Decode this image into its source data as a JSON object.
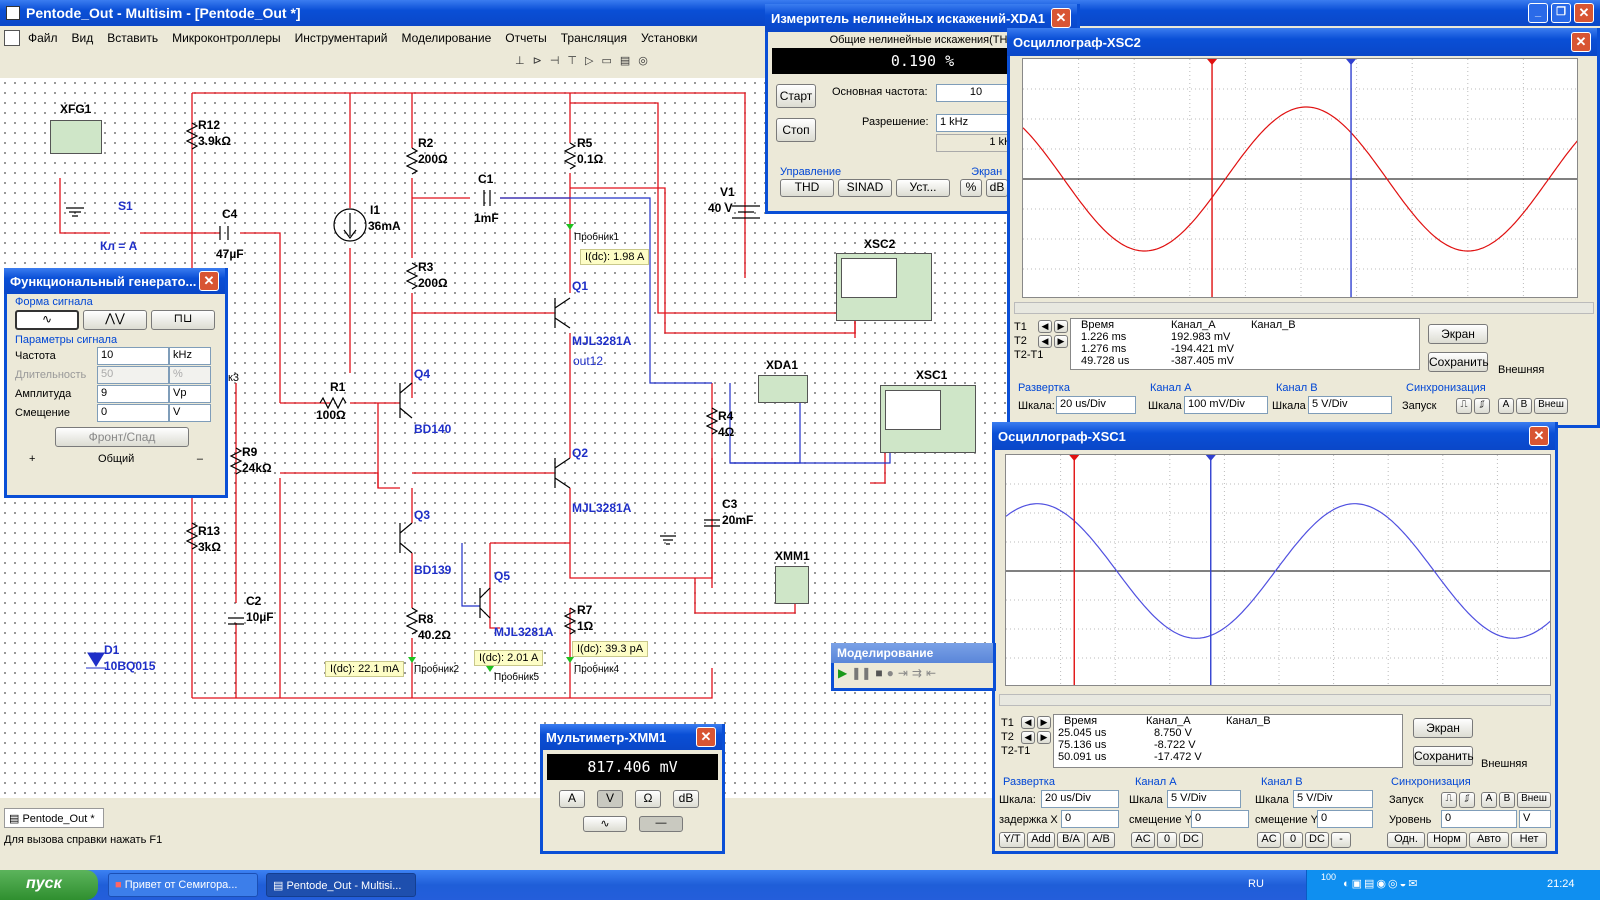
{
  "app": {
    "title": "Pentode_Out - Multisim - [Pentode_Out *]",
    "menu": [
      "Файл",
      "Вид",
      "Вставить",
      "Микроконтроллеры",
      "Инструментарий",
      "Моделирование",
      "Отчеты",
      "Трансляция",
      "Установки"
    ],
    "doc_tab": "Pentode_Out *",
    "status": "Для вызова справки нажать F1"
  },
  "schematic": {
    "components": [
      {
        "ref": "XFG1"
      },
      {
        "ref": "R12",
        "value": "3.9kΩ"
      },
      {
        "ref": "S1",
        "value": "Кл = A"
      },
      {
        "ref": "C4",
        "value": "47µF"
      },
      {
        "ref": "I1",
        "value": "36mA"
      },
      {
        "ref": "R2",
        "value": "200Ω"
      },
      {
        "ref": "C1",
        "value": "1mF"
      },
      {
        "ref": "R5",
        "value": "0.1Ω"
      },
      {
        "ref": "V1",
        "value": "40 V"
      },
      {
        "ref": "R3",
        "value": "200Ω"
      },
      {
        "ref": "Q1",
        "value": "MJL3281A"
      },
      {
        "ref": "R1",
        "value": "100Ω"
      },
      {
        "ref": "Q4",
        "value": "BD140"
      },
      {
        "ref": "R9",
        "value": "24kΩ"
      },
      {
        "ref": "Q2",
        "value": "MJL3281A"
      },
      {
        "ref": "R4",
        "value": "4Ω"
      },
      {
        "ref": "C3",
        "value": "20mF"
      },
      {
        "ref": "Q3",
        "value": "BD139"
      },
      {
        "ref": "Q5",
        "value": "MJL3281A"
      },
      {
        "ref": "R13",
        "value": "3kΩ"
      },
      {
        "ref": "C2",
        "value": "10µF"
      },
      {
        "ref": "R8",
        "value": "40.2Ω"
      },
      {
        "ref": "R7",
        "value": "1Ω"
      },
      {
        "ref": "D1",
        "value": "10BQ015"
      },
      {
        "ref": "XSC2"
      },
      {
        "ref": "XDA1"
      },
      {
        "ref": "XSC1"
      },
      {
        "ref": "XMM1"
      }
    ],
    "probes": [
      {
        "label": "Пробник1",
        "value": "I(dc): 1.98 A"
      },
      {
        "label": "Пробник2",
        "value": "I(dc): 22.1 mA"
      },
      {
        "label": "Пробник5",
        "value": "I(dc): 2.01 A"
      },
      {
        "label": "Пробник4",
        "value": "I(dc): 39.3 pA"
      }
    ],
    "net_label": "out12",
    "partial_label": "к3"
  },
  "funcgen": {
    "title": "Функциональный генерато...",
    "group_wave": "Форма сигнала",
    "group_params": "Параметры сигнала",
    "params": [
      {
        "label": "Частота",
        "value": "10",
        "unit": "kHz",
        "enabled": true
      },
      {
        "label": "Длительность",
        "value": "50",
        "unit": "%",
        "enabled": false
      },
      {
        "label": "Амплитуда",
        "value": "9",
        "unit": "Vp",
        "enabled": true
      },
      {
        "label": "Смещение",
        "value": "0",
        "unit": "V",
        "enabled": true
      }
    ],
    "edge_button": "Фронт/Спад",
    "plus": "+",
    "common": "Общий",
    "minus": "–"
  },
  "distortion": {
    "title": "Измеритель нелинейных искажений-XDA1",
    "header": "Общие нелинейные искажения(THD",
    "display": "0.190 %",
    "start": "Старт",
    "stop": "Стоп",
    "fund_label": "Основная частота:",
    "fund_value": "10",
    "res_label": "Разрешение:",
    "res_value": "1 kHz",
    "res_extra": "1 kH",
    "ctrl_group": "Управление",
    "screen_group": "Экран",
    "buttons": [
      "THD",
      "SINAD",
      "Уст..."
    ],
    "screen_buttons": [
      "%",
      "dB"
    ]
  },
  "xsc2": {
    "title": "Осциллограф-XSC2",
    "cols": [
      "Время",
      "Канал_A",
      "Канал_B"
    ],
    "rows": [
      {
        "label": "T1",
        "time": "1.226 ms",
        "a": "192.983 mV",
        "b": ""
      },
      {
        "label": "T2",
        "time": "1.276 ms",
        "a": "-194.421 mV",
        "b": ""
      },
      {
        "label": "T2-T1",
        "time": "49.728 us",
        "a": "-387.405 mV",
        "b": ""
      }
    ],
    "btn_screen": "Экран",
    "btn_save": "Сохранить",
    "external": "Внешняя",
    "sweep": "Развертка",
    "scale_label": "Шкала:",
    "scale": "20 us/Div",
    "cha": "Канал A",
    "cha_scale_label": "Шкала",
    "cha_scale": "100 mV/Div",
    "chb": "Канал B",
    "chb_scale_label": "Шкала",
    "chb_scale": "5  V/Div",
    "sync": "Синхронизация",
    "trigger": "Запуск",
    "trig_buttons": [
      "A",
      "B",
      "Внеш"
    ],
    "color_a": "#e01010"
  },
  "xsc1": {
    "title": "Осциллограф-XSC1",
    "cols": [
      "Время",
      "Канал_A",
      "Канал_B"
    ],
    "rows": [
      {
        "label": "T1",
        "time": "25.045 us",
        "a": "8.750 V",
        "b": ""
      },
      {
        "label": "T2",
        "time": "75.136 us",
        "a": "-8.722 V",
        "b": ""
      },
      {
        "label": "T2-T1",
        "time": "50.091 us",
        "a": "-17.472 V",
        "b": ""
      }
    ],
    "btn_screen": "Экран",
    "btn_save": "Сохранить",
    "external": "Внешняя",
    "sweep": "Развертка",
    "scale_label": "Шкала:",
    "scale": "20 us/Div",
    "delay_label": "задержка X",
    "delay": "0",
    "cha": "Канал A",
    "cha_scale_label": "Шкала",
    "cha_scale": "5  V/Div",
    "cha_off_label": "смещение Y",
    "cha_off": "0",
    "chb": "Канал B",
    "chb_scale_label": "Шкала",
    "chb_scale": "5  V/Div",
    "chb_off_label": "смещение Y",
    "chb_off": "0",
    "sync": "Синхронизация",
    "trigger": "Запуск",
    "level_label": "Уровень",
    "level": "0",
    "level_unit": "V",
    "trig_buttons": [
      "A",
      "B",
      "Внеш"
    ],
    "bottom_buttons": [
      "Y/T",
      "Add",
      "B/A",
      "A/B"
    ],
    "couple_a": [
      "AC",
      "0",
      "DC"
    ],
    "couple_b": [
      "AC",
      "0",
      "DC",
      "-"
    ],
    "mode_buttons": [
      "Одн.",
      "Норм",
      "Авто",
      "Нет"
    ],
    "color_a": "#5050e0"
  },
  "multimeter": {
    "title": "Мультиметр-XMM1",
    "display": "817.406 mV",
    "buttons": [
      "A",
      "V",
      "Ω",
      "dB"
    ]
  },
  "simctrl": {
    "title": "Моделирование"
  },
  "taskbar": {
    "start": "пуск",
    "tasks": [
      "Привет от Семигора...",
      "Pentode_Out - Multisi..."
    ],
    "lang": "RU",
    "clock": "21:24",
    "tray_num": "100"
  }
}
